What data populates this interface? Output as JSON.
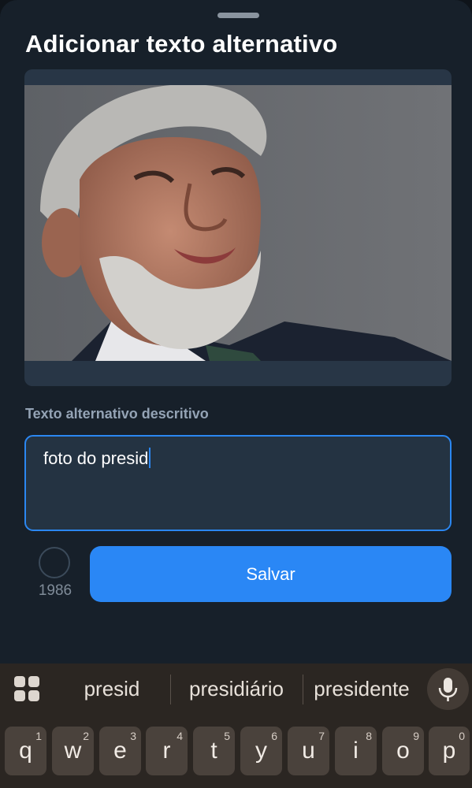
{
  "sheet": {
    "title": "Adicionar texto alternativo"
  },
  "image": {
    "subject": "photo-portrait"
  },
  "alt_text": {
    "label": "Texto alternativo descritivo",
    "value": "foto do presid"
  },
  "counter": {
    "value": "1986"
  },
  "save_button": {
    "label": "Salvar"
  },
  "suggestions": [
    "presid",
    "presidiário",
    "presidente"
  ],
  "keyboard": {
    "row1": [
      {
        "letter": "q",
        "num": "1"
      },
      {
        "letter": "w",
        "num": "2"
      },
      {
        "letter": "e",
        "num": "3"
      },
      {
        "letter": "r",
        "num": "4"
      },
      {
        "letter": "t",
        "num": "5"
      },
      {
        "letter": "y",
        "num": "6"
      },
      {
        "letter": "u",
        "num": "7"
      },
      {
        "letter": "i",
        "num": "8"
      },
      {
        "letter": "o",
        "num": "9"
      },
      {
        "letter": "p",
        "num": "0"
      }
    ]
  },
  "colors": {
    "accent": "#2a87f5",
    "sheet_bg": "#17202a",
    "keyboard_bg": "#2b2622"
  }
}
